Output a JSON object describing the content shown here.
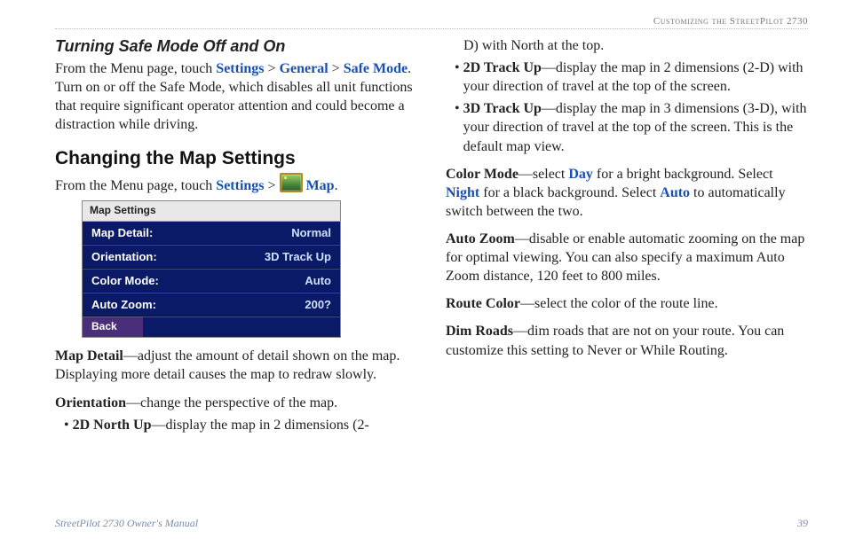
{
  "header": {
    "breadcrumb": "Customizing the StreetPilot 2730"
  },
  "footer": {
    "left": "StreetPilot 2730 Owner's Manual",
    "page": "39"
  },
  "left": {
    "safeMode": {
      "title": "Turning Safe Mode Off and On",
      "intro_pre": "From the Menu page, touch ",
      "settings": "Settings",
      "gt1": " > ",
      "general": "General",
      "gt2": " > ",
      "safe": "Safe Mode",
      "intro_post": ". Turn on or off the Safe Mode, which disables all unit functions that require significant operator attention and could become a distraction while driving."
    },
    "mapSettings": {
      "title": "Changing the Map Settings",
      "intro_pre": "From the Menu page, touch ",
      "settings": "Settings",
      "gt": " > ",
      "map": "Map",
      "period": "."
    },
    "device": {
      "title": "Map Settings",
      "rows": [
        {
          "label": "Map Detail:",
          "value": "Normal"
        },
        {
          "label": "Orientation:",
          "value": "3D Track Up"
        },
        {
          "label": "Color Mode:",
          "value": "Auto"
        },
        {
          "label": "Auto Zoom:",
          "value": "200?"
        }
      ],
      "back": "Back"
    },
    "mapDetail": {
      "term": "Map Detail",
      "dash": "—",
      "text": "adjust the amount of detail shown on the map. Displaying more detail causes the map to redraw slowly."
    },
    "orientation": {
      "term": "Orientation",
      "dash": "—",
      "text": "change the perspective of the map."
    },
    "b2dNorth": {
      "term": "2D North Up",
      "dash": "—",
      "text": "display the map in 2 dimensions (2-"
    }
  },
  "right": {
    "cont1": "D) with North at the top.",
    "b2dTrack": {
      "term": "2D Track Up",
      "dash": "—",
      "text": "display the map in 2 dimensions (2-D) with your direction of travel at the top of the screen."
    },
    "b3dTrack": {
      "term": "3D Track Up",
      "dash": "—",
      "text": "display the map in 3 dimensions (3-D), with your direction of travel at the top of the screen. This is the default map view."
    },
    "colorMode": {
      "term": "Color Mode",
      "dash": "—",
      "pre": "select ",
      "day": "Day",
      "mid1": " for a bright background. Select ",
      "night": "Night",
      "mid2": " for a black background. Select ",
      "auto": "Auto",
      "post": " to automatically switch between the two."
    },
    "autoZoom": {
      "term": "Auto Zoom",
      "dash": "—",
      "text": "disable or enable automatic zooming on the map for optimal viewing. You can also specify a maximum Auto Zoom distance, 120 feet to 800 miles."
    },
    "routeColor": {
      "term": "Route Color",
      "dash": "—",
      "text": "select the color of the route line."
    },
    "dimRoads": {
      "term": "Dim Roads",
      "dash": "—",
      "text": "dim roads that are not on your route. You can customize this setting to Never or While Routing."
    }
  }
}
